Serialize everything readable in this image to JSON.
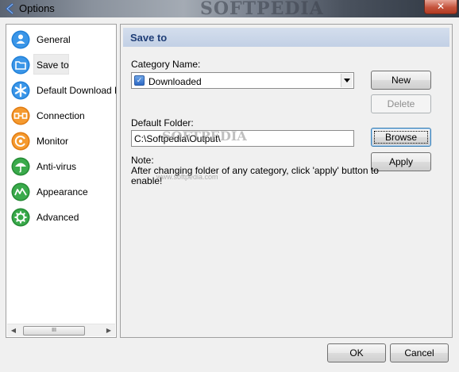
{
  "window": {
    "title": "Options",
    "close_glyph": "✕",
    "watermark": "SOFTPEDIA"
  },
  "nav": {
    "items": [
      {
        "label": "General",
        "icon": "person-icon",
        "color": "#1f7fd8"
      },
      {
        "label": "Save to",
        "icon": "folder-icon",
        "color": "#1f7fd8"
      },
      {
        "label": "Default Download Pr",
        "icon": "asterisk-icon",
        "color": "#1f7fd8"
      },
      {
        "label": "Connection",
        "icon": "connection-icon",
        "color": "#f08a1a"
      },
      {
        "label": "Monitor",
        "icon": "monitor-icon",
        "color": "#f08a1a"
      },
      {
        "label": "Anti-virus",
        "icon": "umbrella-icon",
        "color": "#2e9a3c"
      },
      {
        "label": "Appearance",
        "icon": "appearance-icon",
        "color": "#2e9a3c"
      },
      {
        "label": "Advanced",
        "icon": "gear-icon",
        "color": "#2e9a3c"
      }
    ],
    "selected_index": 1,
    "scrollbar": {
      "left_arrow": "◀",
      "right_arrow": "▶",
      "thumb_grip": "III"
    }
  },
  "panel": {
    "header": "Save to",
    "category_label": "Category Name:",
    "category_value": "Downloaded",
    "folder_label": "Default Folder:",
    "folder_value": "C:\\Softpedia\\Output\\",
    "folder_watermark": "SOFTPEDIA",
    "note_title": "Note:",
    "note_line1": "After changing folder of any category, click 'apply' button to",
    "note_line2": "enable!",
    "watermark_small": "www.softpedia.com",
    "buttons": {
      "new": "New",
      "delete": "Delete",
      "browse": "Browse",
      "apply": "Apply"
    }
  },
  "footer": {
    "ok": "OK",
    "cancel": "Cancel"
  },
  "colors": {
    "header_text": "#1f3e77",
    "header_band": "#c8d5e8",
    "close_button": "#c4533c"
  }
}
